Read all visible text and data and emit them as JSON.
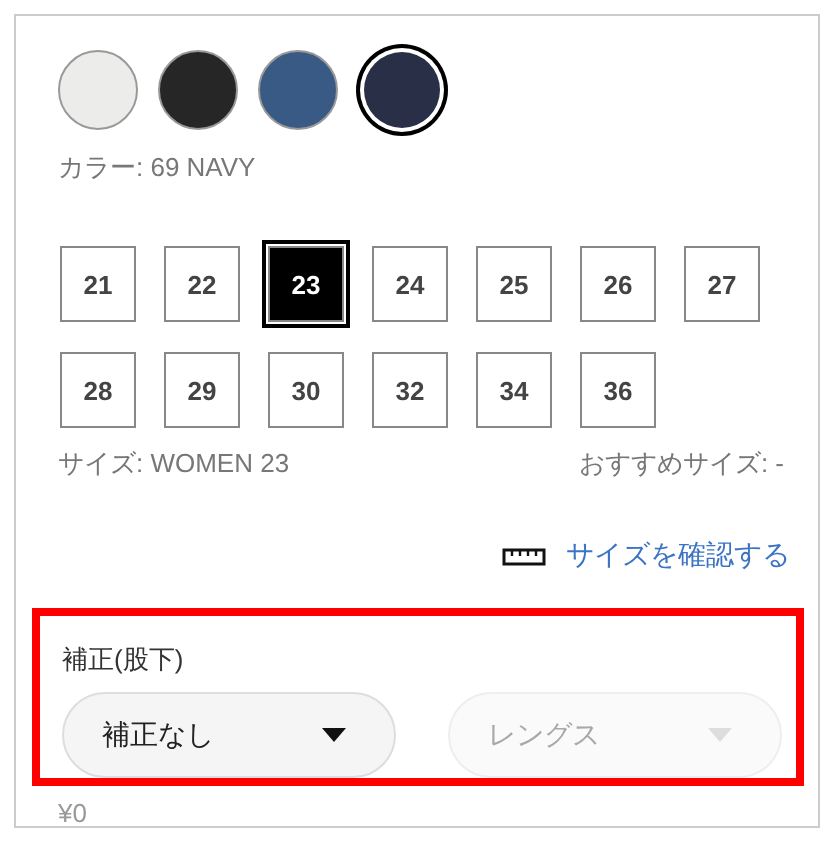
{
  "colors": [
    {
      "color": "#ececea",
      "selected": false
    },
    {
      "color": "#262626",
      "selected": false
    },
    {
      "color": "#3a5a86",
      "selected": false
    },
    {
      "color": "#2a2f48",
      "selected": true
    }
  ],
  "color_label": "カラー: 69 NAVY",
  "sizes": [
    {
      "label": "21",
      "selected": false
    },
    {
      "label": "22",
      "selected": false
    },
    {
      "label": "23",
      "selected": true
    },
    {
      "label": "24",
      "selected": false
    },
    {
      "label": "25",
      "selected": false
    },
    {
      "label": "26",
      "selected": false
    },
    {
      "label": "27",
      "selected": false
    },
    {
      "label": "28",
      "selected": false
    },
    {
      "label": "29",
      "selected": false
    },
    {
      "label": "30",
      "selected": false
    },
    {
      "label": "32",
      "selected": false
    },
    {
      "label": "34",
      "selected": false
    },
    {
      "label": "36",
      "selected": false
    }
  ],
  "size_label": "サイズ: WOMEN 23",
  "recommended_size": "おすすめサイズ: -",
  "size_check_link": "サイズを確認する",
  "alteration": {
    "highlighted": true,
    "title": "補正(股下)",
    "selects": [
      {
        "value": "補正なし",
        "disabled": false
      },
      {
        "value": "レングス",
        "disabled": true
      }
    ]
  },
  "price": "¥0"
}
